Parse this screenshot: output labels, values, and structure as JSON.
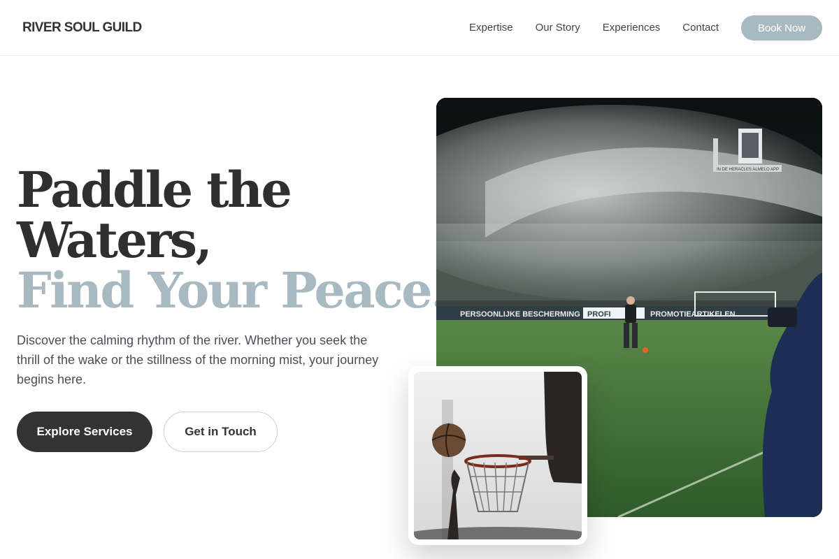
{
  "header": {
    "brand": "RIVER SOUL GUILD",
    "nav": [
      "Expertise",
      "Our Story",
      "Experiences",
      "Contact"
    ],
    "cta": "Book Now"
  },
  "hero": {
    "title_line1": "Paddle the",
    "title_line2": "Waters,",
    "title_accent": "Find Your Peace.",
    "description": "Discover the calming rhythm of the river. Whether you seek the thrill of the wake or the stillness of the morning mist, your journey begins here.",
    "primary_button": "Explore Services",
    "secondary_button": "Get in Touch"
  },
  "photos": {
    "main_banners": [
      "PERSOONLIJKE BESCHERMING",
      "PROFI",
      "PROMOTIEARTIKELEN"
    ],
    "main_board": "IN DE HERACLES ALMELO APP"
  },
  "colors": {
    "accent": "#a9b9c1",
    "dark": "#333333"
  }
}
